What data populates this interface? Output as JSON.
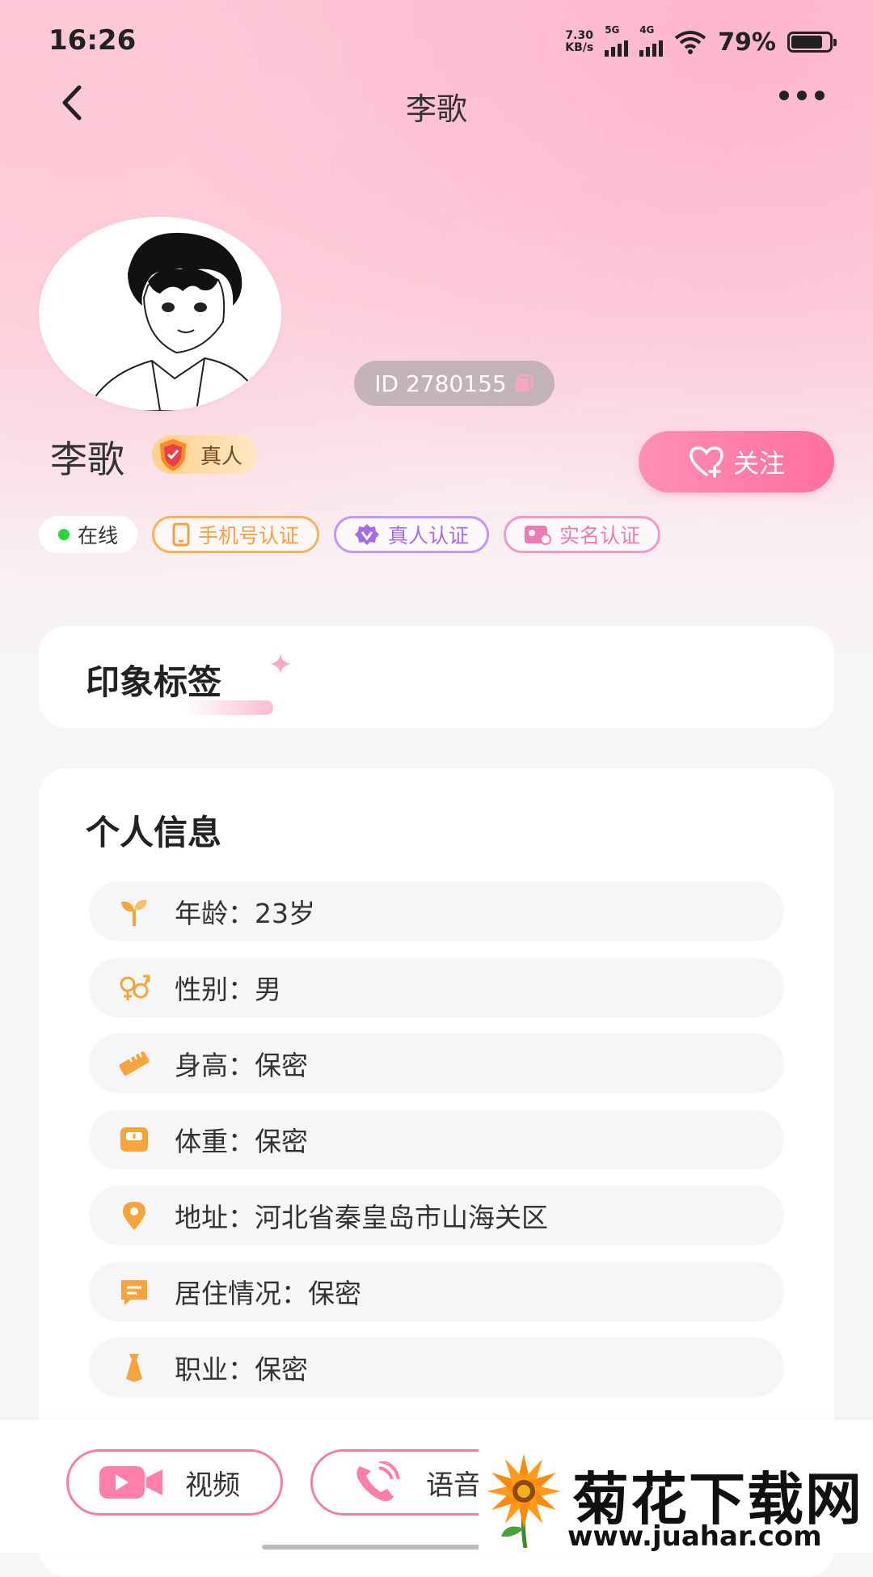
{
  "status_bar": {
    "time": "16:26",
    "net_speed_top": "7.30",
    "net_speed_bottom": "KB/s",
    "sim1": "5G",
    "sim2": "4G",
    "battery": "79%"
  },
  "header": {
    "title": "李歌"
  },
  "profile": {
    "id_text": "ID 2780155",
    "name": "李歌",
    "real_badge": "真人",
    "follow_label": "关注",
    "tags": {
      "online": "在线",
      "phone": "手机号认证",
      "real_person": "真人认证",
      "real_name": "实名认证"
    }
  },
  "impression": {
    "title": "印象标签"
  },
  "info": {
    "title": "个人信息",
    "rows": [
      {
        "icon": "sprout-icon",
        "text": "年龄：23岁"
      },
      {
        "icon": "gender-icon",
        "text": "性别：男"
      },
      {
        "icon": "ruler-icon",
        "text": "身高：保密"
      },
      {
        "icon": "scale-icon",
        "text": "体重：保密"
      },
      {
        "icon": "location-icon",
        "text": "地址：河北省秦皇岛市山海关区"
      },
      {
        "icon": "home-note-icon",
        "text": "居住情况：保密"
      },
      {
        "icon": "tie-icon",
        "text": "职业：保密"
      }
    ]
  },
  "bottom": {
    "video_label": "视频",
    "voice_label": "语音"
  },
  "watermark": {
    "title": "菊花下载网",
    "url": "www.juahar.com"
  },
  "colors": {
    "accent_pink": "#ff6f9f",
    "online_green": "#26d63a",
    "phone_orange": "#f2a040",
    "real_purple": "#a86be8",
    "realname_pink": "#ec7bb2"
  }
}
